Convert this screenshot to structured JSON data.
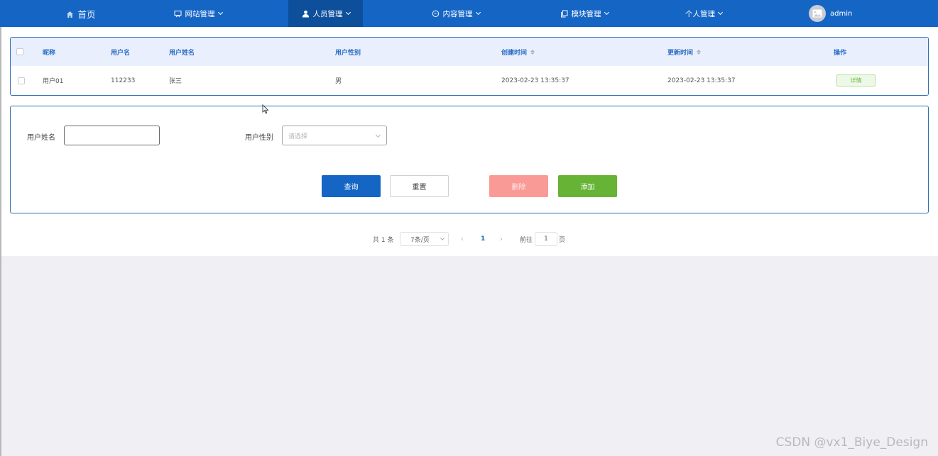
{
  "nav": {
    "items": [
      {
        "label": "首页",
        "icon": "home-icon",
        "active": false,
        "dropdown": false
      },
      {
        "label": "网站管理",
        "icon": "monitor-icon",
        "active": false,
        "dropdown": true
      },
      {
        "label": "人员管理",
        "icon": "user-icon",
        "active": true,
        "dropdown": true
      },
      {
        "label": "内容管理",
        "icon": "chat-icon",
        "active": false,
        "dropdown": true
      },
      {
        "label": "模块管理",
        "icon": "copy-icon",
        "active": false,
        "dropdown": true
      },
      {
        "label": "个人管理",
        "icon": "",
        "active": false,
        "dropdown": true
      }
    ],
    "user": "admin"
  },
  "table": {
    "headers": [
      "昵称",
      "用户名",
      "用户姓名",
      "用户性别",
      "创建时间",
      "更新时间",
      "操作"
    ],
    "rows": [
      {
        "nickname": "用户01",
        "username": "112233",
        "realname": "张三",
        "gender": "男",
        "created": "2023-02-23 13:35:37",
        "updated": "2023-02-23 13:35:37",
        "action": "详情"
      }
    ]
  },
  "form": {
    "name_label": "用户姓名",
    "name_value": "",
    "gender_label": "用户性别",
    "gender_placeholder": "请选择",
    "query_label": "查询",
    "reset_label": "重置",
    "delete_label": "删除",
    "add_label": "添加"
  },
  "pager": {
    "total": "共 1 条",
    "page_size": "7条/页",
    "current": "1",
    "goto_label": "前往",
    "goto_value": "1",
    "page_unit": "页"
  },
  "watermark": "CSDN @vx1_Biye_Design",
  "colors": {
    "nav_bg": "#1565c5",
    "nav_active": "#0e4f9c",
    "primary": "#1565c5",
    "delete": "#fa9a96",
    "add": "#66b336"
  }
}
